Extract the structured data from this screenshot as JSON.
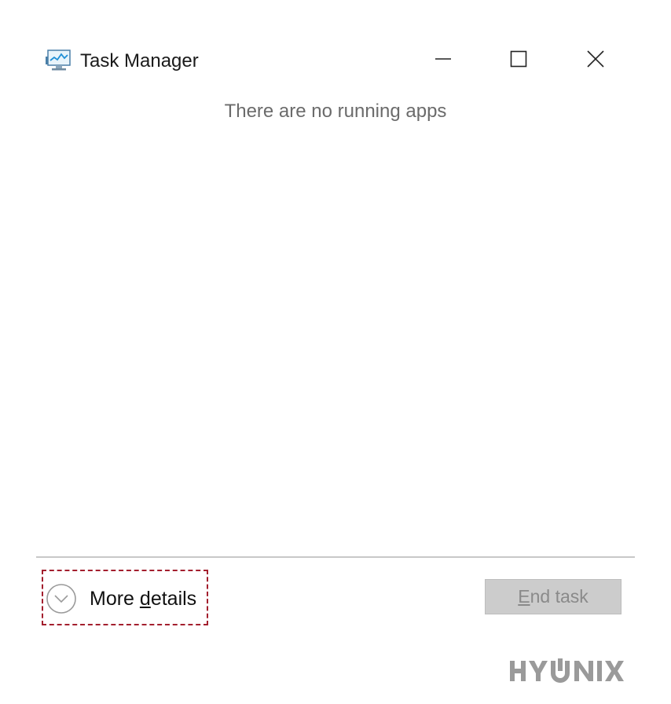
{
  "window": {
    "title": "Task Manager",
    "icon": "task-manager-icon",
    "controls": {
      "minimize_icon": "minimize-icon",
      "maximize_icon": "maximize-icon",
      "close_icon": "close-icon"
    }
  },
  "main": {
    "empty_message": "There are no running apps"
  },
  "footer": {
    "more_details": {
      "icon": "chevron-down-circle-icon",
      "label_prefix": "More ",
      "label_underlined": "d",
      "label_suffix": "etails",
      "highlight_color": "#a31f2e"
    },
    "end_task": {
      "label_underlined": "E",
      "label_suffix": "nd task",
      "enabled": false
    }
  },
  "watermark": {
    "text": "HYUNIX",
    "color": "#9a9a9a"
  }
}
